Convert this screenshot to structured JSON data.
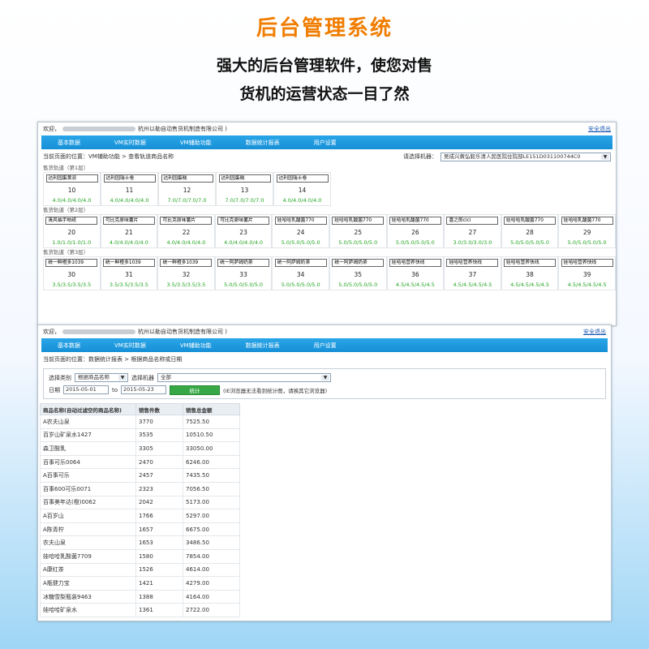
{
  "hero": {
    "title": "后台管理系统",
    "subtitle_line1": "强大的后台管理软件，使您对售",
    "subtitle_line2": "货机的运营状态一目了然"
  },
  "common": {
    "welcome": "欢迎，",
    "company_suffix": "杭州以勒自动售货机制造有限公司 )",
    "logout": "安全退出"
  },
  "screen1": {
    "nav": [
      "基本数据",
      "VM实时数据",
      "VM辅助功能",
      "数据统计报表",
      "用户设置"
    ],
    "breadcrumb": "当前页面的位置：VM辅助功能 > 查看轨道商品名称",
    "machine_label": "请选择机器：",
    "machine_value": "吴成兴黄弘毅乐清人民医院住院部LE151D031100744C0",
    "layers": [
      {
        "label": "售货轨道（第1层）",
        "cells": [
          {
            "name": "达利园蛋黄派",
            "num": "10",
            "vals": "4.0/4.0/4.0/4.0"
          },
          {
            "name": "达利园瑞士卷",
            "num": "11",
            "vals": "4.0/4.0/4.0/4.0"
          },
          {
            "name": "达利园蛋糕",
            "num": "12",
            "vals": "7.0/7.0/7.0/7.0"
          },
          {
            "name": "达利园蛋糕",
            "num": "13",
            "vals": "7.0/7.0/7.0/7.0"
          },
          {
            "name": "达利园瑞士卷",
            "num": "14",
            "vals": "4.0/4.0/4.0/4.0"
          }
        ]
      },
      {
        "label": "售货轨道（第2层）",
        "cells": [
          {
            "name": "清风袖手帕纸",
            "num": "20",
            "vals": "1.0/1.0/1.0/1.0"
          },
          {
            "name": "可比克原味薯片",
            "num": "21",
            "vals": "4.0/4.0/4.0/4.0"
          },
          {
            "name": "可比克原味薯片",
            "num": "22",
            "vals": "4.0/4.0/4.0/4.0"
          },
          {
            "name": "可比克原味薯片",
            "num": "23",
            "vals": "4.0/4.0/4.0/4.0"
          },
          {
            "name": "娃哈哈乳酸菌770",
            "num": "24",
            "vals": "5.0/5.0/5.0/5.0"
          },
          {
            "name": "娃哈哈乳酸菌770",
            "num": "25",
            "vals": "5.0/5.0/5.0/5.0"
          },
          {
            "name": "娃哈哈乳酸菌770",
            "num": "26",
            "vals": "5.0/5.0/5.0/5.0"
          },
          {
            "name": "喜之郎cici",
            "num": "27",
            "vals": "3.0/3.0/3.0/3.0"
          },
          {
            "name": "娃哈哈乳酸菌770",
            "num": "28",
            "vals": "5.0/5.0/5.0/5.0"
          },
          {
            "name": "娃哈哈乳酸菌770",
            "num": "29",
            "vals": "5.0/5.0/5.0/5.0"
          }
        ]
      },
      {
        "label": "售货轨道（第3层）",
        "cells": [
          {
            "name": "统一鲜橙多1039",
            "num": "30",
            "vals": "3.5/3.5/3.5/3.5"
          },
          {
            "name": "统一鲜橙多1039",
            "num": "31",
            "vals": "3.5/3.5/3.5/3.5"
          },
          {
            "name": "统一鲜橙多1039",
            "num": "32",
            "vals": "3.5/3.5/3.5/3.5"
          },
          {
            "name": "统一阿萨姆奶茶",
            "num": "33",
            "vals": "5.0/5.0/5.0/5.0"
          },
          {
            "name": "统一阿萨姆奶茶",
            "num": "34",
            "vals": "5.0/5.0/5.0/5.0"
          },
          {
            "name": "统一阿萨姆奶茶",
            "num": "35",
            "vals": "5.0/5.0/5.0/5.0"
          },
          {
            "name": "娃哈哈营养快线",
            "num": "36",
            "vals": "4.5/4.5/4.5/4.5"
          },
          {
            "name": "娃哈哈营养快线",
            "num": "37",
            "vals": "4.5/4.5/4.5/4.5"
          },
          {
            "name": "娃哈哈营养快线",
            "num": "38",
            "vals": "4.5/4.5/4.5/4.5"
          },
          {
            "name": "娃哈哈营养快线",
            "num": "39",
            "vals": "4.5/4.5/4.5/4.5"
          }
        ]
      }
    ]
  },
  "screen2": {
    "nav": [
      "基本数据",
      "VM实时数据",
      "VM辅助功能",
      "数据统计报表",
      "用户设置"
    ],
    "breadcrumb": "当前页面的位置：数据统计报表 > 根据商品名称或日期",
    "category_label": "选择类别",
    "category_value": "根据商品名称",
    "machine_label": "选择机器",
    "machine_value": "全部",
    "date_label": "日期",
    "date_from": "2015-05-01",
    "date_to_label": "to",
    "date_to": "2015-05-23",
    "stat_button": "统计",
    "note": "(IE浏览器无法看到统计图，请换其它浏览器)",
    "table": {
      "headers": [
        "商品名称(自动过滤空的商品名称)",
        "销售件数",
        "销售总金额"
      ],
      "rows": [
        [
          "A农夫山泉",
          "3770",
          "7525.50"
        ],
        [
          "百岁山矿泉水1427",
          "3535",
          "10510.50"
        ],
        [
          "森卫酸乳",
          "3305",
          "33050.00"
        ],
        [
          "百事可乐0064",
          "2470",
          "6246.00"
        ],
        [
          "A百事可乐",
          "2457",
          "7435.50"
        ],
        [
          "百事600可乐0071",
          "2323",
          "7056.50"
        ],
        [
          "百事美年达(橙)0062",
          "2042",
          "5173.00"
        ],
        [
          "A百岁山",
          "1766",
          "5297.00"
        ],
        [
          "A陈青柠",
          "1657",
          "6675.00"
        ],
        [
          "农夫山泉",
          "1653",
          "3486.50"
        ],
        [
          "娃哈哈乳酸菌7709",
          "1580",
          "7854.00"
        ],
        [
          "A康红茶",
          "1526",
          "4614.00"
        ],
        [
          "A瓶健力宝",
          "1421",
          "4279.00"
        ],
        [
          "冰糖雪梨瓶装9463",
          "1388",
          "4164.00"
        ],
        [
          "娃哈哈矿泉水",
          "1361",
          "2722.00"
        ]
      ]
    }
  }
}
